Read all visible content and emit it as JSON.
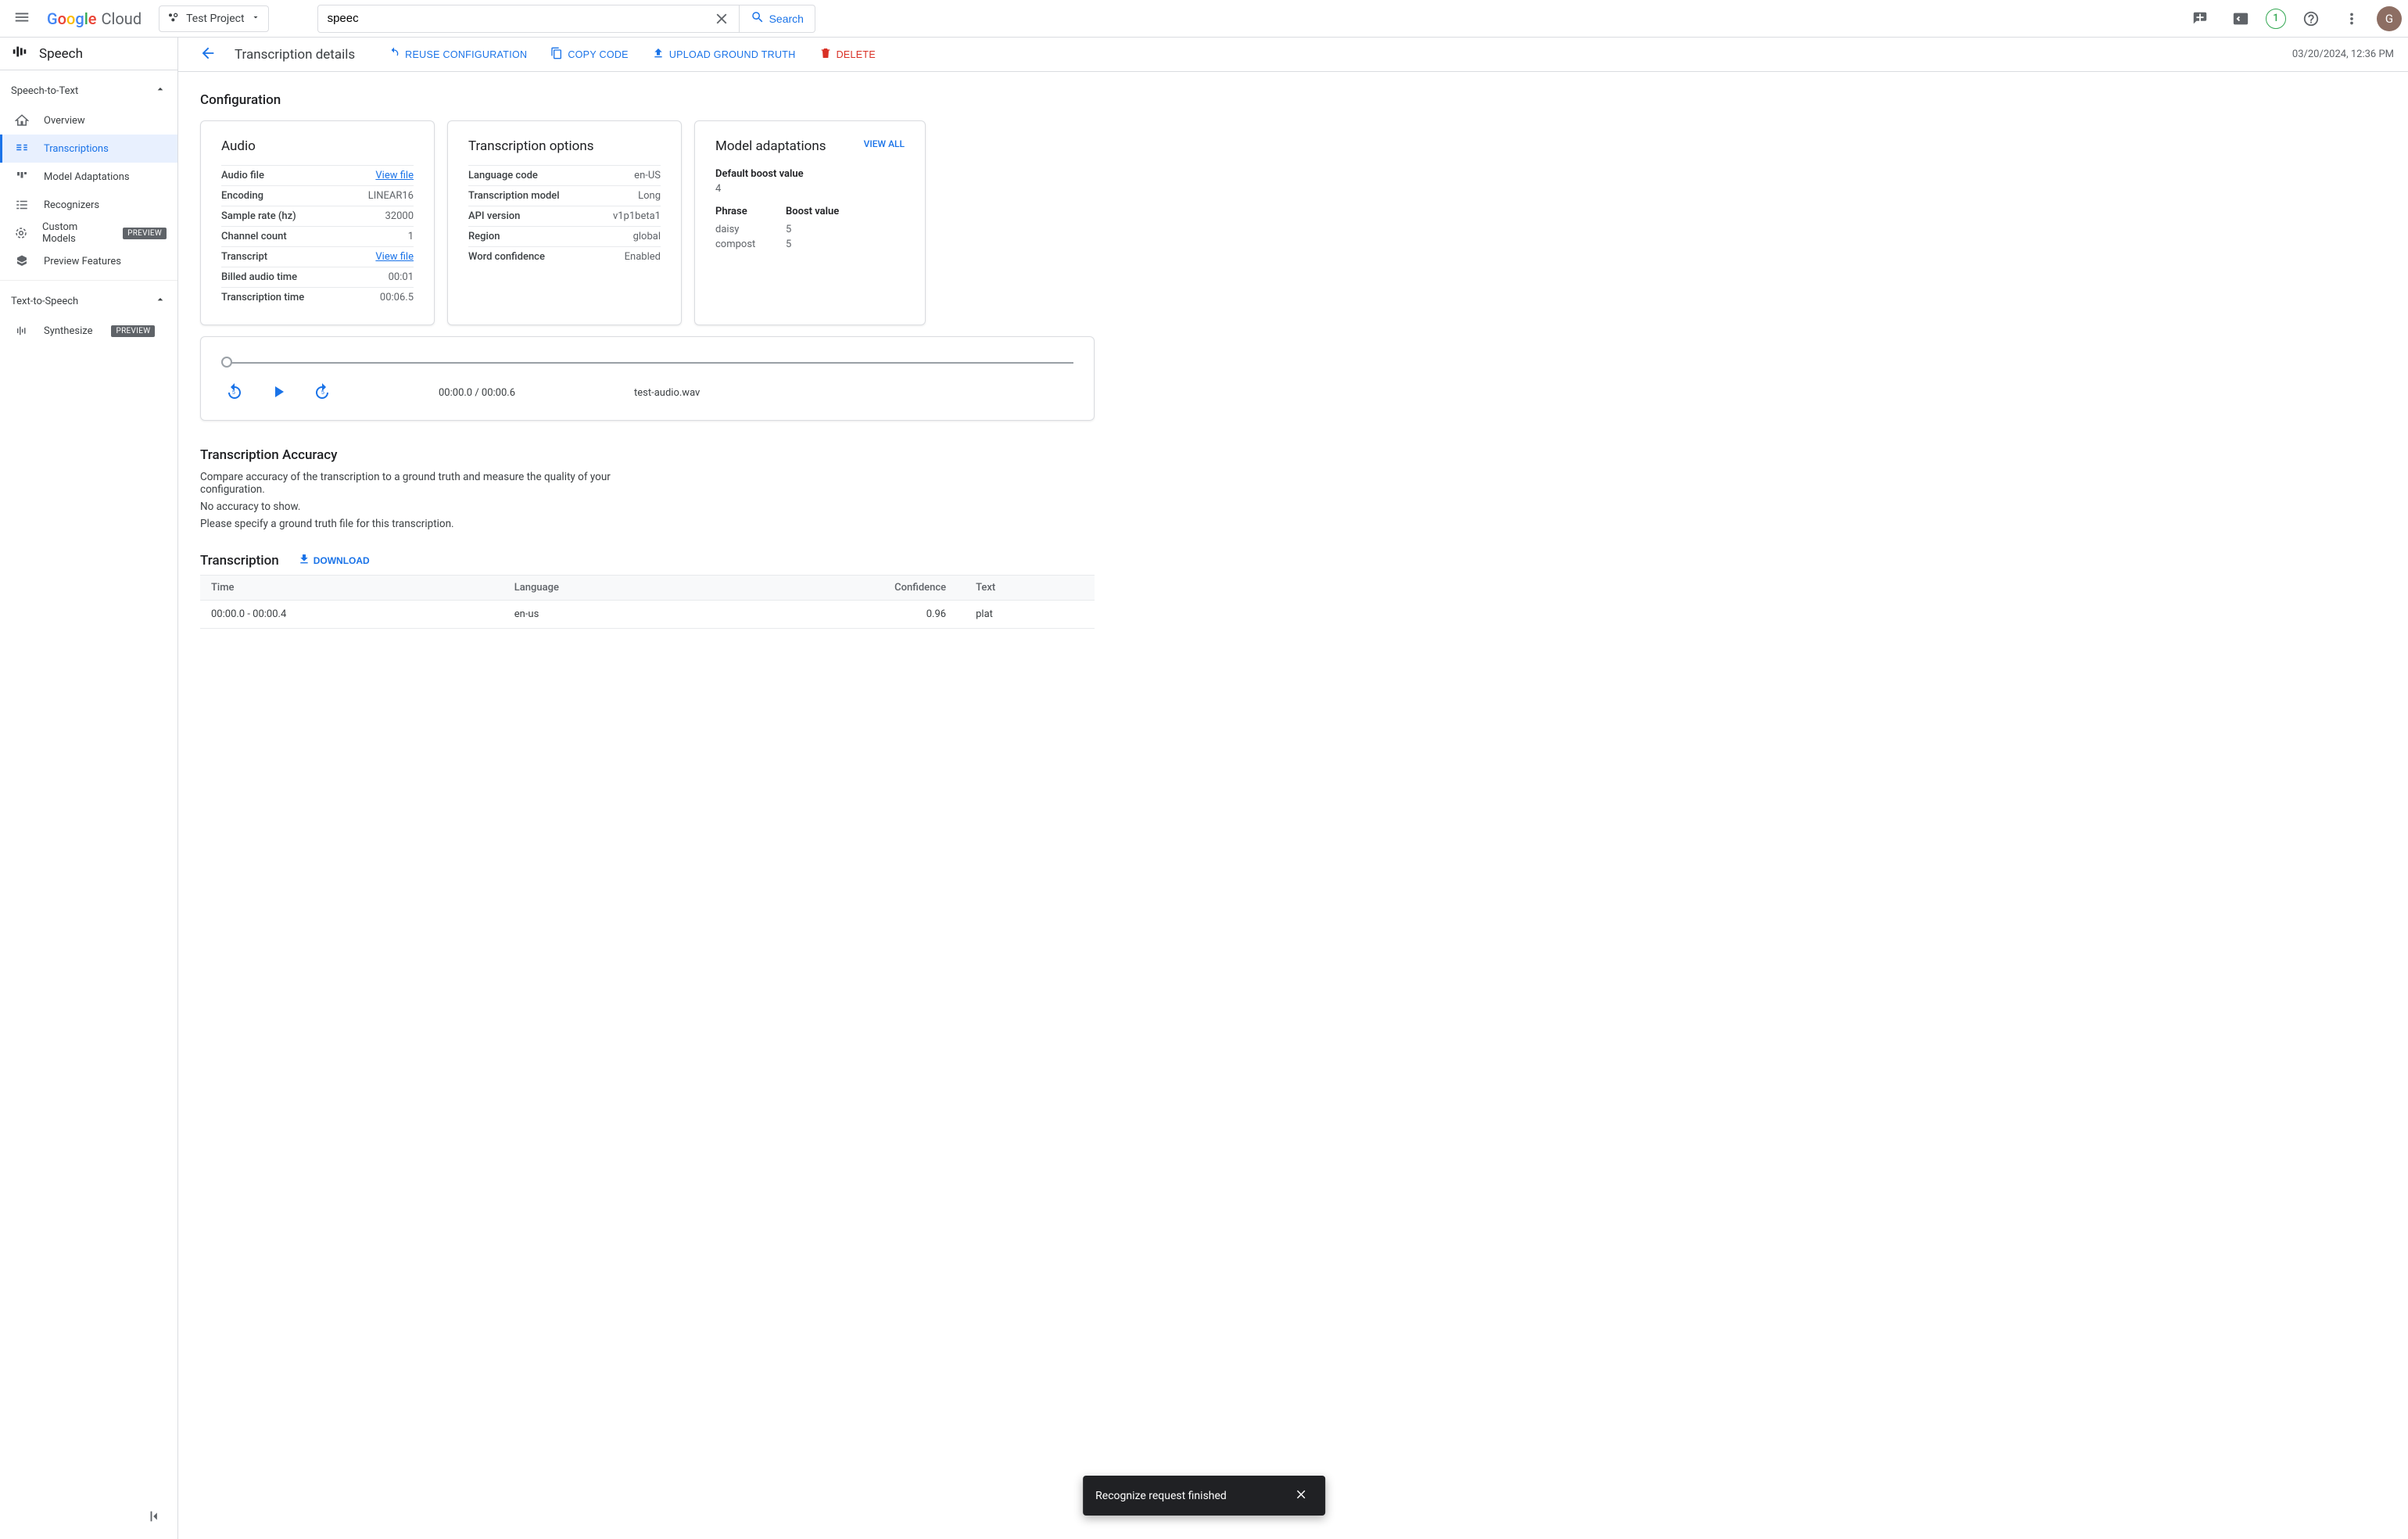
{
  "header": {
    "brand_cloud": "Cloud",
    "project_name": "Test Project",
    "search_value": "speec",
    "search_button": "Search",
    "trial_badge": "1",
    "avatar_letter": "G"
  },
  "sidebar": {
    "product_title": "Speech",
    "group1_title": "Speech-to-Text",
    "items1": [
      {
        "label": "Overview"
      },
      {
        "label": "Transcriptions"
      },
      {
        "label": "Model Adaptations"
      },
      {
        "label": "Recognizers"
      },
      {
        "label": "Custom Models",
        "chip": "PREVIEW"
      },
      {
        "label": "Preview Features"
      }
    ],
    "group2_title": "Text-to-Speech",
    "items2": [
      {
        "label": "Synthesize",
        "chip": "PREVIEW"
      }
    ]
  },
  "actionbar": {
    "title": "Transcription details",
    "reuse": "REUSE CONFIGURATION",
    "copy": "COPY CODE",
    "upload": "UPLOAD GROUND TRUTH",
    "delete": "DELETE",
    "timestamp": "03/20/2024, 12:36 PM"
  },
  "config": {
    "heading": "Configuration",
    "audio": {
      "title": "Audio",
      "rows": [
        {
          "k": "Audio file",
          "v": "View file",
          "link": true
        },
        {
          "k": "Encoding",
          "v": "LINEAR16"
        },
        {
          "k": "Sample rate (hz)",
          "v": "32000"
        },
        {
          "k": "Channel count",
          "v": "1"
        },
        {
          "k": "Transcript",
          "v": "View file",
          "link": true
        },
        {
          "k": "Billed audio time",
          "v": "00:01"
        },
        {
          "k": "Transcription time",
          "v": "00:06.5"
        }
      ]
    },
    "options": {
      "title": "Transcription options",
      "rows": [
        {
          "k": "Language code",
          "v": "en-US"
        },
        {
          "k": "Transcription model",
          "v": "Long"
        },
        {
          "k": "API version",
          "v": "v1p1beta1"
        },
        {
          "k": "Region",
          "v": "global"
        },
        {
          "k": "Word confidence",
          "v": "Enabled"
        }
      ]
    },
    "adapt": {
      "title": "Model adaptations",
      "view_all": "VIEW ALL",
      "default_label": "Default boost value",
      "default_value": "4",
      "col_phrase": "Phrase",
      "col_boost": "Boost value",
      "rows": [
        {
          "phrase": "daisy",
          "boost": "5"
        },
        {
          "phrase": "compost",
          "boost": "5"
        }
      ]
    }
  },
  "player": {
    "time": "00:00.0 / 00:00.6",
    "filename": "test-audio.wav"
  },
  "accuracy": {
    "heading": "Transcription Accuracy",
    "desc": "Compare accuracy of the transcription to a ground truth and measure the quality of your configuration.",
    "none": "No accuracy to show.",
    "specify": "Please specify a ground truth file for this transcription."
  },
  "transcription": {
    "heading": "Transcription",
    "download": "DOWNLOAD",
    "cols": {
      "time": "Time",
      "lang": "Language",
      "conf": "Confidence",
      "text": "Text"
    },
    "rows": [
      {
        "time": "00:00.0 - 00:00.4",
        "lang": "en-us",
        "conf": "0.96",
        "text": "plat"
      }
    ]
  },
  "toast": {
    "msg": "Recognize request finished"
  }
}
